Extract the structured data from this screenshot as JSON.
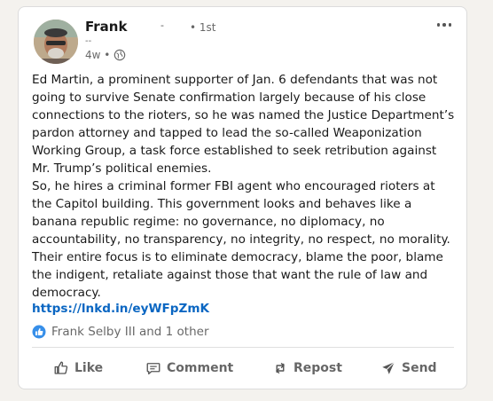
{
  "post": {
    "author": {
      "name": "Frank",
      "degree_sep": "-",
      "degree": "• 1st",
      "headline": "--"
    },
    "time": "4w •",
    "visibility_icon": "globe-icon",
    "menu_icon": "more-icon",
    "body": [
      "Ed Martin, a prominent supporter of Jan. 6 defendants that was not going to survive Senate confirmation largely because of his close connections to the rioters, so he was named the Justice Department’s pardon attorney and tapped to lead the so-called Weaponization Working Group, a task force established to seek retribution against Mr. Trump’s political enemies.",
      "So, he hires a criminal former FBI agent who encouraged rioters at the Capitol building. This government looks and behaves like a banana republic regime: no governance, no diplomacy, no accountability, no transparency, no integrity, no respect, no morality. Their entire focus is to eliminate democracy, blame the poor, blame the indigent, retaliate against those that want the rule of law and democracy."
    ],
    "link": "https://lnkd.in/eyWFpZmK",
    "reactions": {
      "icon": "like-reaction-icon",
      "text": "Frank Selby III and 1 other"
    }
  },
  "actions": {
    "like": "Like",
    "comment": "Comment",
    "repost": "Repost",
    "send": "Send"
  },
  "colors": {
    "link": "#0a66c2",
    "like_reaction": "#378fe9"
  }
}
